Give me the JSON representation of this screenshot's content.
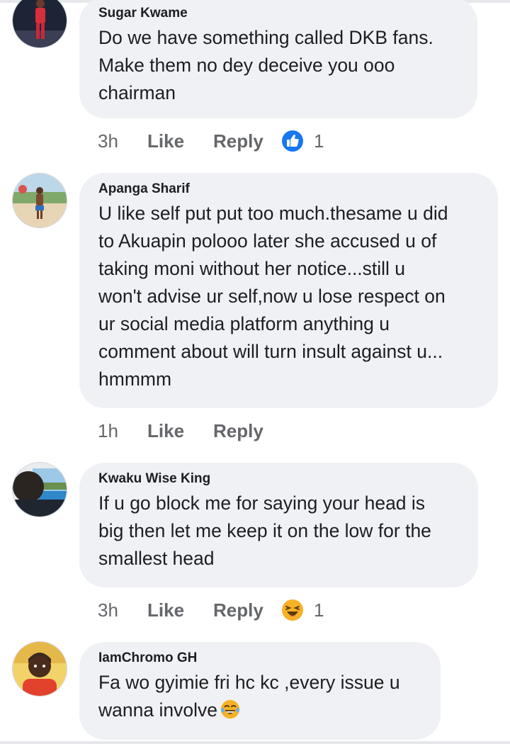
{
  "comments": [
    {
      "author": "Sugar Kwame",
      "lines": [
        "Do we have something called DKB fans.",
        "Make them no dey deceive you ooo",
        "chairman"
      ],
      "time": "3h",
      "like_label": "Like",
      "reply_label": "Reply",
      "reaction_icon": "thumbs-up-icon",
      "reaction_count": "1"
    },
    {
      "author": "Apanga Sharif",
      "lines": [
        "U like self put put too much.thesame u did",
        "to Akuapin polooo later she accused u of",
        "taking moni without her notice...still u",
        "won't advise ur self,now u lose respect on",
        "ur social media platform anything u",
        "comment about will turn insult against u...",
        "hmmmm"
      ],
      "time": "1h",
      "like_label": "Like",
      "reply_label": "Reply"
    },
    {
      "author": "Kwaku Wise King",
      "lines": [
        "If u go block me for saying your head is",
        "big then let me keep it on the low for the",
        "smallest head"
      ],
      "time": "3h",
      "like_label": "Like",
      "reply_label": "Reply",
      "reaction_icon": "haha-icon",
      "reaction_count": "1"
    },
    {
      "author": "IamChromo GH",
      "lines": [
        "Fa wo gyimie fri hc kc ,every issue u",
        "wanna involve"
      ],
      "trailing_emoji": "tears-of-joy-emoji"
    }
  ],
  "colors": {
    "bubble": "#eff1f4",
    "text": "#1c1e21",
    "meta": "#65676b",
    "like_blue": "#1877f2",
    "haha_yellow": "#f7b125"
  }
}
